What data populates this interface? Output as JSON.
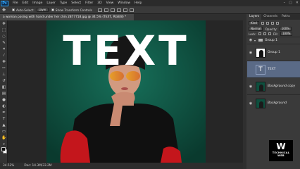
{
  "app": {
    "logo": "Ps"
  },
  "menu": [
    "File",
    "Edit",
    "Image",
    "Layer",
    "Type",
    "Select",
    "Filter",
    "3D",
    "View",
    "Window",
    "Help"
  ],
  "window_controls": {
    "minimize": "–",
    "maximize": "▢",
    "close": "✕"
  },
  "options": {
    "auto_select_label": "Auto-Select:",
    "auto_select_value": "Layer",
    "transform_label": "Show Transform Controls"
  },
  "document": {
    "tab_title": "a woman posing with hand under her chin 2877718.jpg @ 34.5% (TEXT, RGB/8) *",
    "canvas_text": "TEXT"
  },
  "status": {
    "zoom": "34.52%",
    "doc": "Doc: 14.3M/33.2M"
  },
  "panels": {
    "tabs": [
      "Layers",
      "Channels",
      "Paths"
    ],
    "kind_label": "Kind",
    "blend_mode": "Normal",
    "opacity_label": "Opacity:",
    "opacity_value": "100%",
    "lock_label": "Lock:",
    "fill_label": "Fill:",
    "fill_value": "100%",
    "group_name": "Group 1",
    "layers": [
      {
        "name": "Group 1"
      },
      {
        "name": "TEXT"
      },
      {
        "name": "Background copy"
      },
      {
        "name": "Background"
      }
    ]
  },
  "watermark": {
    "mark": "W",
    "line1": "TECHNICAL",
    "line2": "WEB"
  },
  "colors": {
    "canvas_bg": "#0e4f3e",
    "selected_layer": "#5a6a86",
    "accent": "#31a8ff"
  }
}
